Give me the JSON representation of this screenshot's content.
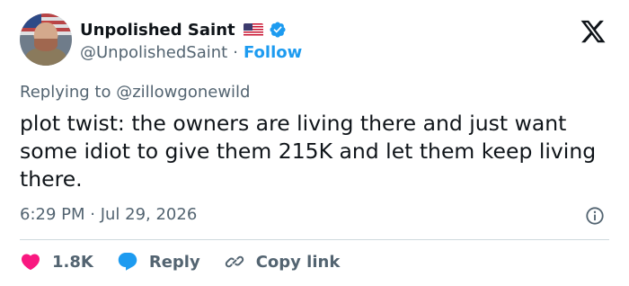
{
  "user": {
    "display_name": "Unpolished Saint",
    "handle": "@UnpolishedSaint",
    "separator": "·",
    "follow_label": "Follow"
  },
  "reply_to": {
    "prefix": "Replying to",
    "mention": "@zillowgonewild"
  },
  "tweet": {
    "text": "plot twist: the owners are living there and just want some idiot to give them 215K and let them keep living there.",
    "timestamp": "6:29 PM · Jul 29, 2026"
  },
  "actions": {
    "likes": "1.8K",
    "reply_label": "Reply",
    "copy_label": "Copy link"
  },
  "colors": {
    "text": "#0f1419",
    "muted": "#536471",
    "accent": "#1d9bf0",
    "like": "#f91880"
  },
  "icons": [
    "verified-icon",
    "x-logo-icon",
    "info-icon",
    "heart-icon",
    "reply-bubble-icon",
    "link-icon",
    "us-flag-icon"
  ]
}
